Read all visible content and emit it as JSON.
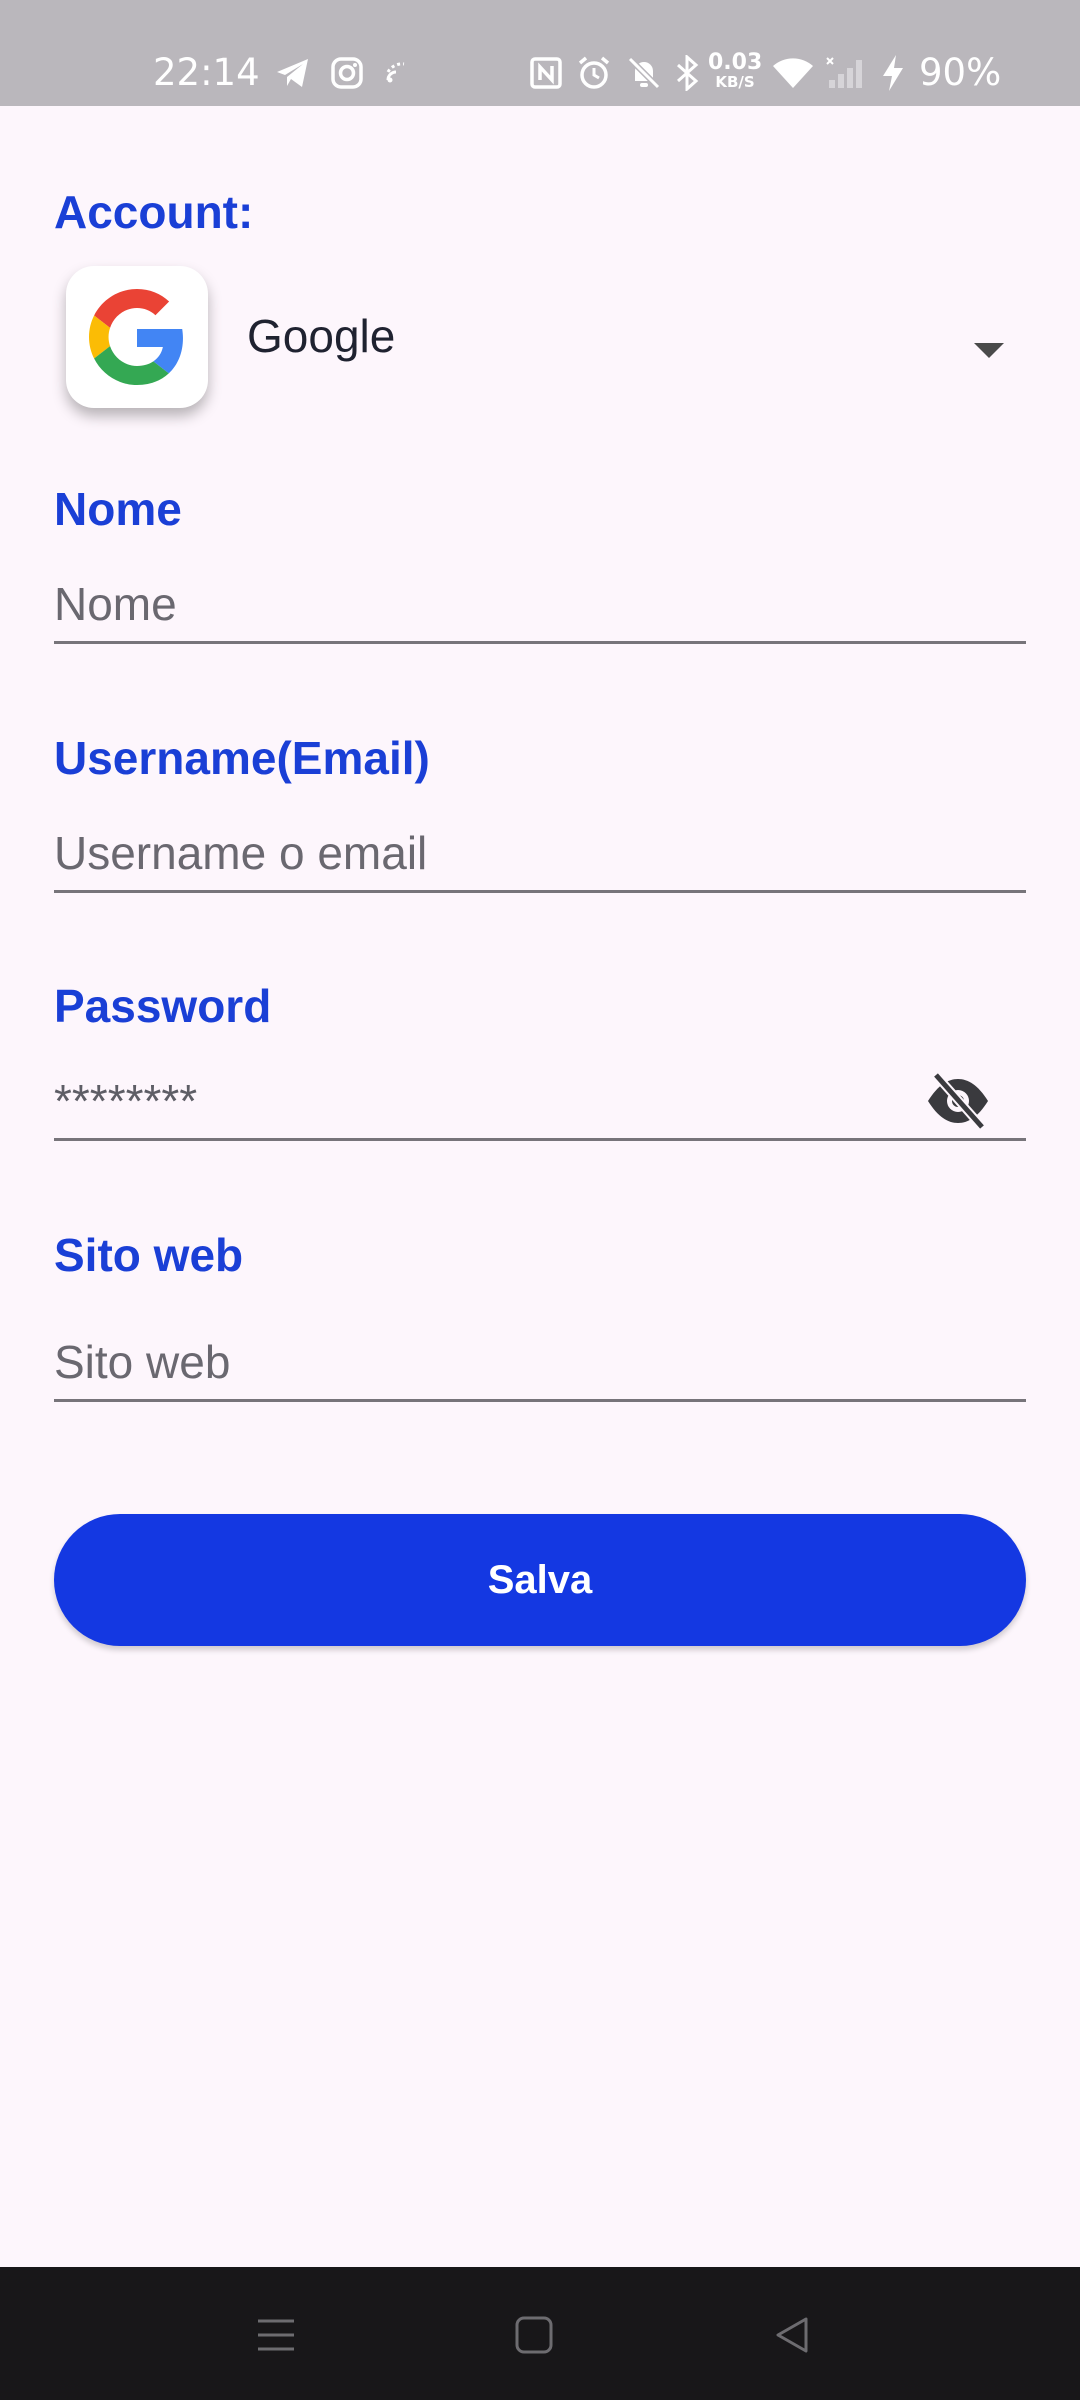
{
  "status_bar": {
    "time": "22:14",
    "net_speed_value": "0.03",
    "net_speed_unit": "KB/S",
    "battery": "90%",
    "icons": [
      "telegram-icon",
      "instagram-icon",
      "cast-icon",
      "nfc-icon",
      "alarm-icon",
      "mute-icon",
      "bluetooth-icon",
      "wifi-icon",
      "signal-icon",
      "charging-icon"
    ]
  },
  "form": {
    "account_label": "Account:",
    "account_selected": "Google",
    "account_icon": "google-logo",
    "name_label": "Nome",
    "name_placeholder": "Nome",
    "username_label": "Username(Email)",
    "username_placeholder": "Username o email",
    "password_label": "Password",
    "password_value": "********",
    "password_toggle_icon": "eye-off-icon",
    "website_label": "Sito web",
    "website_placeholder": "Sito web",
    "save_label": "Salva"
  },
  "colors": {
    "accent": "#1438e2",
    "label": "#1a3fd6",
    "background": "#fdf6fc"
  },
  "nav_bar": {
    "icons": [
      "recents-icon",
      "home-icon",
      "back-icon"
    ]
  }
}
